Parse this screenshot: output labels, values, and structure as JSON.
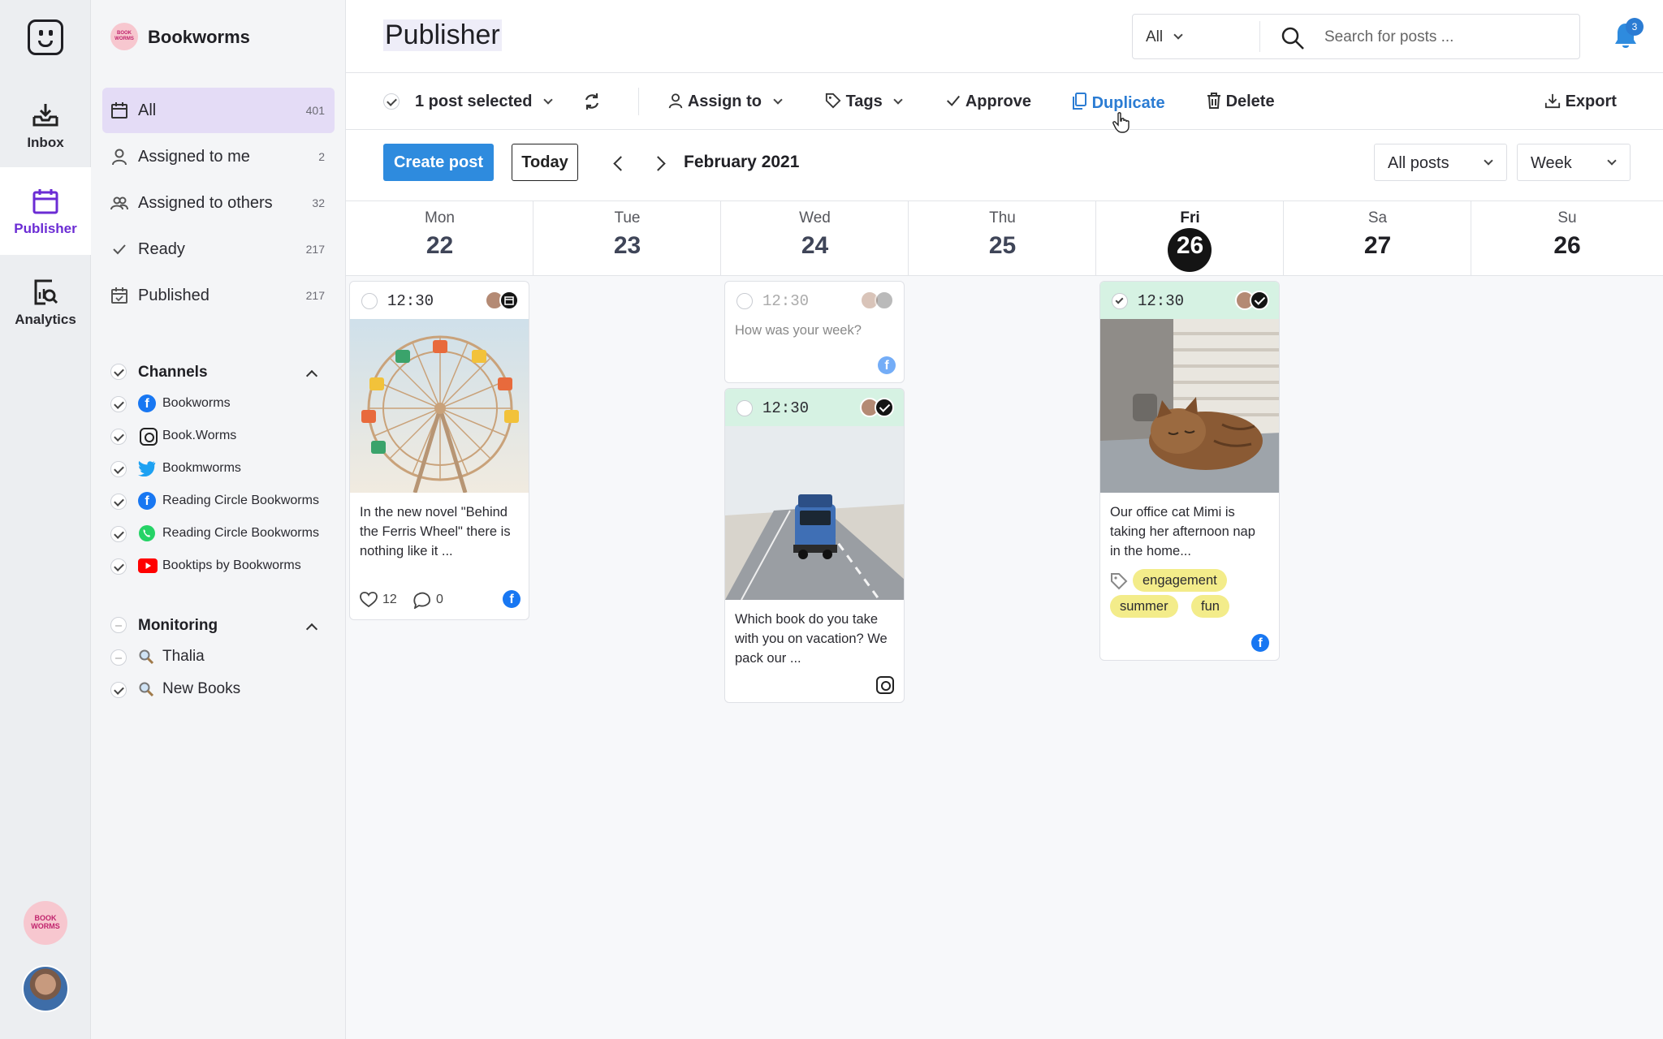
{
  "rail": {
    "items": [
      {
        "label": "Inbox"
      },
      {
        "label": "Publisher"
      },
      {
        "label": "Analytics"
      }
    ],
    "brand_avatar_text": "BOOK WORMS"
  },
  "sidebar": {
    "brand": "Bookworms",
    "brand_dot_text": "BOOK WORMS",
    "filters": [
      {
        "label": "All",
        "count": "401"
      },
      {
        "label": "Assigned to me",
        "count": "2"
      },
      {
        "label": "Assigned to others",
        "count": "32"
      },
      {
        "label": "Ready",
        "count": "217"
      },
      {
        "label": "Published",
        "count": "217"
      }
    ],
    "channels_title": "Channels",
    "channels": [
      {
        "name": "Bookworms",
        "network": "facebook"
      },
      {
        "name": "Book.Worms",
        "network": "instagram"
      },
      {
        "name": "Bookmworms",
        "network": "twitter"
      },
      {
        "name": "Reading Circle Bookworms",
        "network": "facebook"
      },
      {
        "name": "Reading Circle Bookworms",
        "network": "whatsapp"
      },
      {
        "name": "Booktips by Bookworms",
        "network": "youtube"
      }
    ],
    "monitoring_title": "Monitoring",
    "monitoring": [
      {
        "name": "Thalia"
      },
      {
        "name": "New Books"
      }
    ]
  },
  "header": {
    "title": "Publisher",
    "filter_value": "All",
    "search_placeholder": "Search for posts ...",
    "notifications": "3"
  },
  "toolbar": {
    "selected": "1 post selected",
    "assign": "Assign to",
    "tags": "Tags",
    "approve": "Approve",
    "duplicate": "Duplicate",
    "delete": "Delete",
    "export": "Export"
  },
  "controls": {
    "create": "Create post",
    "today": "Today",
    "month": "February 2021",
    "post_filter": "All posts",
    "view": "Week"
  },
  "calendar": {
    "days": [
      {
        "name": "Mon",
        "num": "22"
      },
      {
        "name": "Tue",
        "num": "23"
      },
      {
        "name": "Wed",
        "num": "24"
      },
      {
        "name": "Thu",
        "num": "25"
      },
      {
        "name": "Fri",
        "num": "26"
      },
      {
        "name": "Sa",
        "num": "27"
      },
      {
        "name": "Su",
        "num": "26"
      }
    ],
    "posts": {
      "mon": {
        "time": "12:30",
        "text": "In the new novel \"Behind the Ferris Wheel\" there is nothing like it ...",
        "likes": "12",
        "comments": "0"
      },
      "wed1": {
        "time": "12:30",
        "text": "How was your week?"
      },
      "wed2": {
        "time": "12:30",
        "text": "Which book do you take with you on vacation? We pack our ..."
      },
      "fri": {
        "time": "12:30",
        "text": "Our office cat Mimi is taking her afternoon nap in the home...",
        "tags": [
          "engagement",
          "summer",
          "fun"
        ]
      }
    }
  },
  "colors": {
    "accent": "#6b2cd4",
    "primary_button": "#2e8bde",
    "approved_header": "#d6f2e3",
    "tag": "#f3ec8a"
  }
}
